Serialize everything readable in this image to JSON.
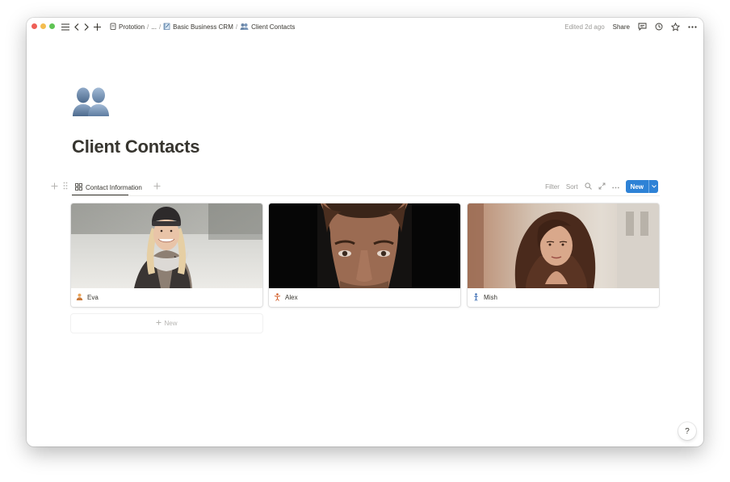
{
  "topbar": {
    "breadcrumbs": [
      {
        "label": "Prototion",
        "icon": "document-hand-icon"
      },
      {
        "label": "..."
      },
      {
        "label": "Basic Business CRM",
        "icon": "notebook-icon"
      },
      {
        "label": "Client Contacts",
        "icon": "busts-icon"
      }
    ],
    "separator": "/",
    "edited": "Edited 2d ago",
    "share_label": "Share"
  },
  "page": {
    "icon": "busts-in-silhouette-icon",
    "title": "Client Contacts"
  },
  "database": {
    "view_tab_label": "Contact Information",
    "view_tab_icon": "gallery-grid-icon",
    "actions": {
      "filter": "Filter",
      "sort": "Sort",
      "new": "New"
    },
    "cards": [
      {
        "name": "Eva",
        "icon": "person-icon"
      },
      {
        "name": "Alex",
        "icon": "person-cartwheel-icon"
      },
      {
        "name": "Mish",
        "icon": "person-standing-icon"
      }
    ],
    "new_row_label": "New"
  },
  "help_label": "?",
  "colors": {
    "accent": "#2e82d6",
    "text": "#37352f",
    "muted": "#9b9a97"
  }
}
